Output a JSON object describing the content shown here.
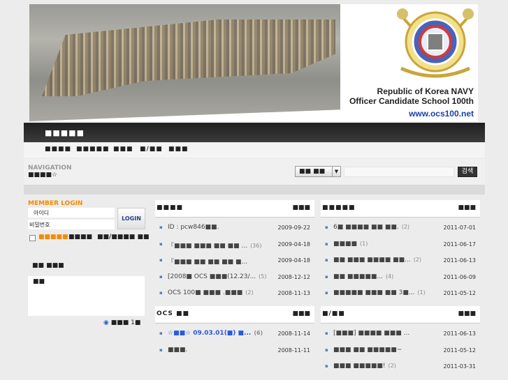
{
  "header": {
    "title_line1": "Republic of Korea NAVY",
    "title_line2": "Officer Candidate School 100th",
    "url": "www.ocs100.net"
  },
  "menu": {
    "title": "■■■■■"
  },
  "subnav": [
    "■■■■",
    "■■■■■",
    "■■■",
    "■/■■",
    "■■■"
  ],
  "navigation": {
    "label": "NAVIGATION",
    "crumb": "■■■■☆"
  },
  "search": {
    "select": "■■ ■■",
    "button": "검색",
    "value": ""
  },
  "login": {
    "title": "MEMBER LOGIN",
    "id_label": "아이디",
    "pw_label": "비밀번호",
    "button": "LOGIN",
    "remember": "■■■■■",
    "join": "■■■■",
    "find": "■■/■■■■ ■■"
  },
  "visitor": {
    "title": "■■ ■■■",
    "box_text": "■■",
    "online": "■■■ 1■"
  },
  "boards": [
    {
      "title": "■■■■",
      "more": "■■■",
      "rows": [
        {
          "title": "ID : pcw846■■.",
          "comments": "",
          "date": "2009-09-22"
        },
        {
          "title": "『■■■ ■■■ ■■ ■■ ...",
          "comments": "(36)",
          "date": "2009-04-18"
        },
        {
          "title": "『■■■ ■■ ■■ ■■ ■...",
          "comments": "",
          "date": "2009-04-18"
        },
        {
          "title": "[2008■ OCS ■■■(12.23/...",
          "comments": "(5)",
          "date": "2008-12-12"
        },
        {
          "title": "OCS 100■ ■■■ .■■■",
          "comments": "(2)",
          "date": "2008-11-13"
        }
      ]
    },
    {
      "title": "■■■■■",
      "more": "■■■",
      "rows": [
        {
          "title": "6■ ■■■■ ■■ ■■.",
          "comments": "(2)",
          "date": "2011-07-01"
        },
        {
          "title": "■■■■",
          "comments": "(1)",
          "date": "2011-06-17"
        },
        {
          "title": "■■ ■■■ ■■■■ ■■...",
          "comments": "(2)",
          "date": "2011-06-13"
        },
        {
          "title": "■■ ■■■■■...",
          "comments": "(4)",
          "date": "2011-06-09"
        },
        {
          "title": "■■■■■ ■■■ ■■ 3■...",
          "comments": "(1)",
          "date": "2011-05-12"
        }
      ]
    },
    {
      "title": "OCS ■■",
      "more": "■■■",
      "rows": [
        {
          "title": "☆■■☆ 09.03.01(■) ■...",
          "comments": "(6)",
          "date": "2008-11-14",
          "highlight": true
        },
        {
          "title": "■■■.",
          "comments": "",
          "date": "2008-11-11"
        }
      ]
    },
    {
      "title": "■/■■",
      "more": "■■■",
      "rows": [
        {
          "title": "[■■■] ■■■■ ■■■ ...",
          "comments": "",
          "date": "2011-06-13"
        },
        {
          "title": "■■■ ■■ ■■■■■~",
          "comments": "",
          "date": "2011-05-12"
        },
        {
          "title": "■■■ ■■■■■!",
          "comments": "(2)",
          "date": "2011-03-31"
        }
      ]
    }
  ],
  "colors": {
    "accent": "#f28c00",
    "nav_dark": "#2a2a2a",
    "link_blue": "#2a5ad8"
  }
}
